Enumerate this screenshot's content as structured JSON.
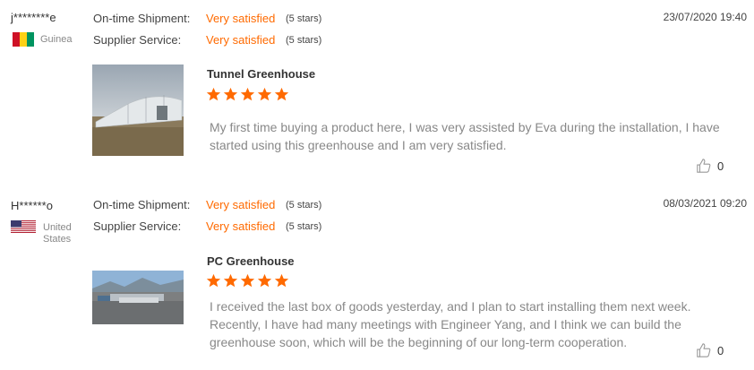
{
  "colors": {
    "accent": "#ff6a00",
    "text": "#444444",
    "muted": "#888888"
  },
  "reviews": [
    {
      "username": "j********e",
      "country": "Guinea",
      "flag_icon": "guinea-flag-icon",
      "shipment_label": "On-time Shipment:",
      "shipment_value": "Very satisfied",
      "shipment_stars": "(5 stars)",
      "service_label": "Supplier Service:",
      "service_value": "Very satisfied",
      "service_stars": "(5 stars)",
      "date": "23/07/2020 19:40",
      "product": "Tunnel Greenhouse",
      "rating": 5,
      "comment": "My first time buying a product here, I was very assisted by Eva during the installation, I have started using this greenhouse and I am very satisfied.",
      "likes": "0"
    },
    {
      "username": "H******o",
      "country": "United States",
      "flag_icon": "us-flag-icon",
      "shipment_label": "On-time Shipment:",
      "shipment_value": "Very satisfied",
      "shipment_stars": "(5 stars)",
      "service_label": "Supplier Service:",
      "service_value": "Very satisfied",
      "service_stars": "(5 stars)",
      "date": "08/03/2021 09:20",
      "product": "PC Greenhouse",
      "rating": 5,
      "comment": "I received the last box of goods yesterday, and I plan to start installing them next week. Recently, I have had many meetings with Engineer Yang, and I think we can build the greenhouse soon, which will be the beginning of our long-term cooperation.",
      "likes": "0"
    }
  ]
}
